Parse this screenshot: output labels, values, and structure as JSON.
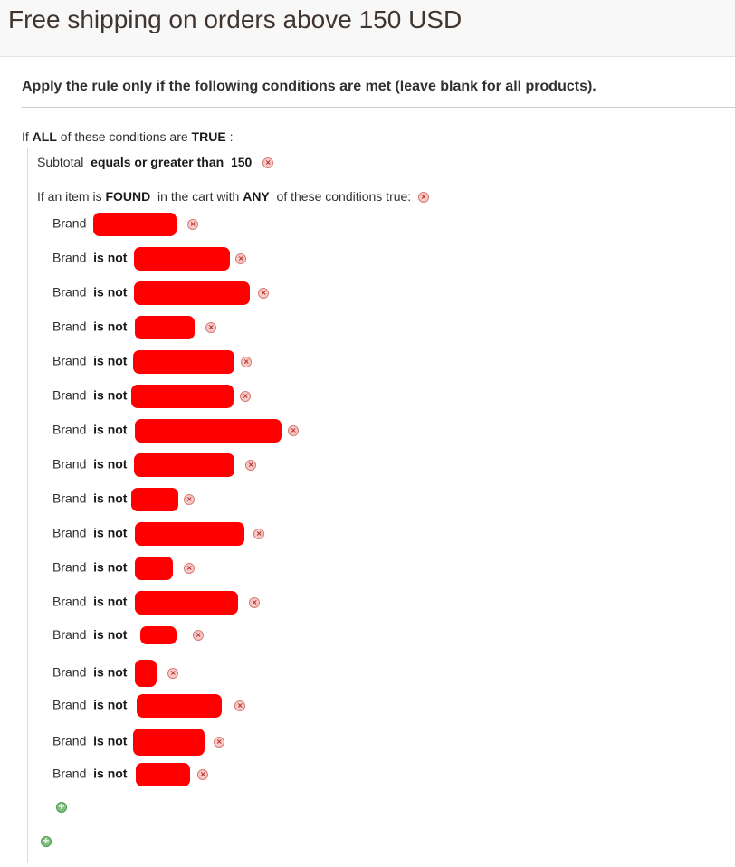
{
  "page": {
    "title": "Free shipping on orders above 150 USD",
    "section_heading": "Apply the rule only if the following conditions are met (leave blank for all products)."
  },
  "conditions": {
    "root": {
      "prefix": "If",
      "aggregator": "ALL",
      "middle": "of these conditions are",
      "value": "TRUE",
      "suffix": ":"
    },
    "subtotal": {
      "attribute": "Subtotal",
      "operator": "equals or greater than",
      "value": "150"
    },
    "found": {
      "prefix": "If an item is",
      "found": "FOUND",
      "middle": "in the cart with",
      "aggregator": "ANY",
      "suffix": "of these conditions true:"
    },
    "brand_rows": [
      {
        "attribute": "Brand",
        "operator": ""
      },
      {
        "attribute": "Brand",
        "operator": "is not"
      },
      {
        "attribute": "Brand",
        "operator": "is not"
      },
      {
        "attribute": "Brand",
        "operator": "is not"
      },
      {
        "attribute": "Brand",
        "operator": "is not"
      },
      {
        "attribute": "Brand",
        "operator": "is not"
      },
      {
        "attribute": "Brand",
        "operator": "is not"
      },
      {
        "attribute": "Brand",
        "operator": "is not"
      },
      {
        "attribute": "Brand",
        "operator": "is not"
      },
      {
        "attribute": "Brand",
        "operator": "is not"
      },
      {
        "attribute": "Brand",
        "operator": "is not"
      },
      {
        "attribute": "Brand",
        "operator": "is not"
      },
      {
        "attribute": "Brand",
        "operator": "is not"
      },
      {
        "attribute": "Brand",
        "operator": "is not"
      },
      {
        "attribute": "Brand",
        "operator": "is not"
      },
      {
        "attribute": "Brand",
        "operator": "is not"
      },
      {
        "attribute": "Brand",
        "operator": "is not"
      }
    ]
  },
  "icons": {
    "remove": "remove-icon",
    "add": "add-icon"
  },
  "colors": {
    "redaction": "#ff0000",
    "remove_icon": "#d77a74",
    "add_icon": "#4a9a4a"
  }
}
